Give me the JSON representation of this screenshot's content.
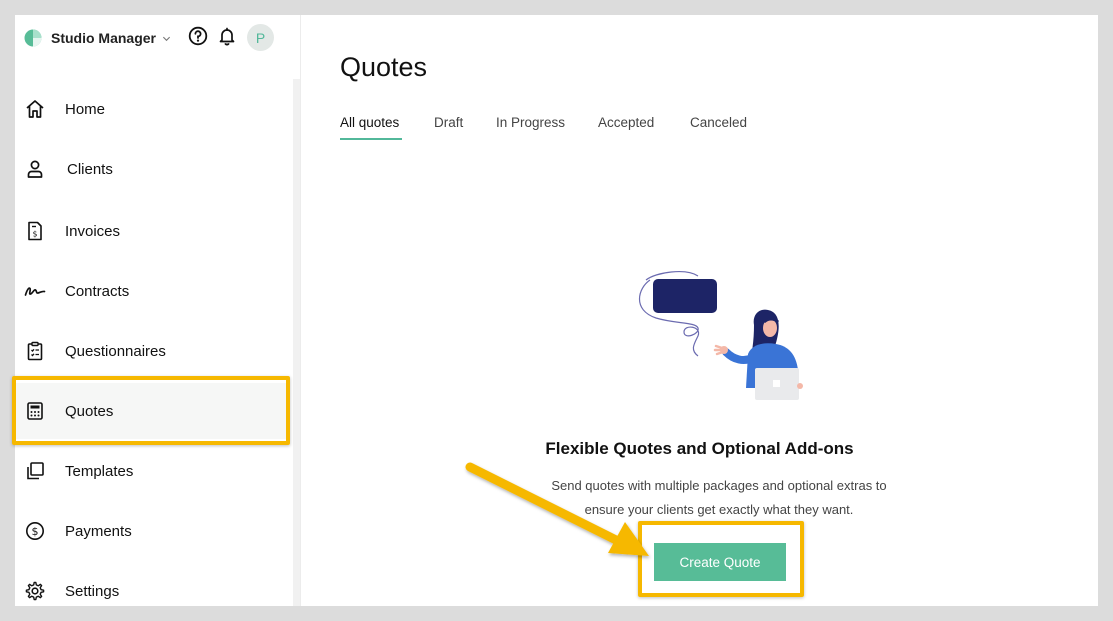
{
  "brand": {
    "name": "Studio Manager",
    "logo_icon": "leaf-logo-icon",
    "accent": "#57bc97"
  },
  "header": {
    "help_icon": "question-circle-icon",
    "notifications_icon": "bell-icon",
    "avatar_initial": "P"
  },
  "sidebar": {
    "items": [
      {
        "label": "Home",
        "icon": "home-icon"
      },
      {
        "label": "Clients",
        "icon": "user-icon"
      },
      {
        "label": "Invoices",
        "icon": "invoice-icon"
      },
      {
        "label": "Contracts",
        "icon": "signature-icon"
      },
      {
        "label": "Questionnaires",
        "icon": "clipboard-icon"
      },
      {
        "label": "Quotes",
        "icon": "calculator-icon",
        "active": true
      },
      {
        "label": "Templates",
        "icon": "templates-icon"
      },
      {
        "label": "Payments",
        "icon": "dollar-circle-icon"
      },
      {
        "label": "Settings",
        "icon": "gear-icon"
      }
    ]
  },
  "main": {
    "title": "Quotes",
    "tabs": [
      {
        "label": "All quotes",
        "active": true
      },
      {
        "label": "Draft"
      },
      {
        "label": "In Progress"
      },
      {
        "label": "Accepted"
      },
      {
        "label": "Canceled"
      }
    ],
    "empty_state": {
      "illustration": "woman-laptop-speech-bubble-illustration",
      "title": "Flexible Quotes and Optional Add-ons",
      "description_line1": "Send quotes with multiple packages and optional extras to",
      "description_line2": "ensure your clients get exactly what they want.",
      "cta_label": "Create Quote"
    }
  },
  "annotation": {
    "highlight_color": "#f6b800"
  }
}
